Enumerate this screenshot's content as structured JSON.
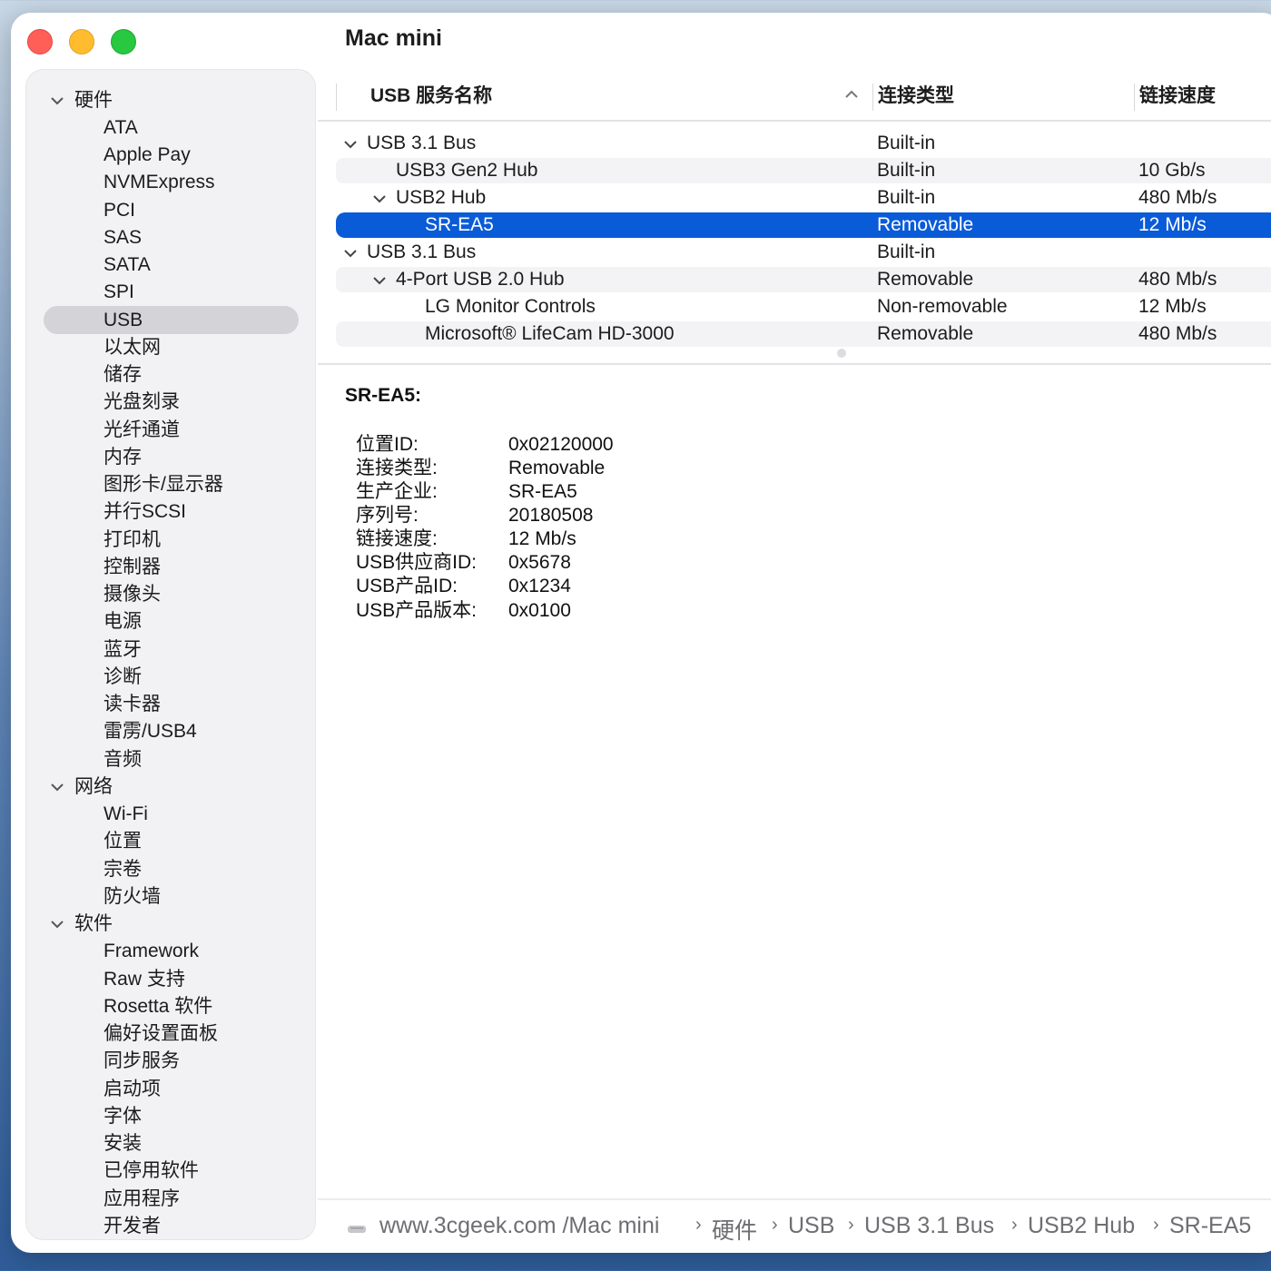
{
  "window": {
    "title": "Mac mini"
  },
  "sidebar": {
    "groups": [
      {
        "label": "硬件"
      },
      {
        "label": "网络"
      },
      {
        "label": "软件"
      }
    ],
    "hardware_items": [
      "ATA",
      "Apple Pay",
      "NVMExpress",
      "PCI",
      "SAS",
      "SATA",
      "SPI",
      "USB",
      "以太网",
      "储存",
      "光盘刻录",
      "光纤通道",
      "内存",
      "图形卡/显示器",
      "并行SCSI",
      "打印机",
      "控制器",
      "摄像头",
      "电源",
      "蓝牙",
      "诊断",
      "读卡器",
      "雷雳/USB4",
      "音频"
    ],
    "network_items": [
      "Wi-Fi",
      "位置",
      "宗卷",
      "防火墙"
    ],
    "software_items": [
      "Framework",
      "Raw 支持",
      "Rosetta 软件",
      "偏好设置面板",
      "同步服务",
      "启动项",
      "字体",
      "安装",
      "已停用软件",
      "应用程序",
      "开发者"
    ],
    "selected": "USB"
  },
  "table": {
    "columns": [
      "USB 服务名称",
      "连接类型",
      "链接速度"
    ],
    "sort_icon": "chevron-up-icon",
    "rows": [
      {
        "name": "USB 3.1 Bus",
        "type": "Built-in",
        "speed": ""
      },
      {
        "name": "USB3 Gen2 Hub",
        "type": "Built-in",
        "speed": "10 Gb/s"
      },
      {
        "name": "USB2 Hub",
        "type": "Built-in",
        "speed": "480 Mb/s"
      },
      {
        "name": "SR-EA5",
        "type": "Removable",
        "speed": "12 Mb/s"
      },
      {
        "name": "USB 3.1 Bus",
        "type": "Built-in",
        "speed": ""
      },
      {
        "name": "4-Port USB 2.0 Hub",
        "type": "Removable",
        "speed": "480 Mb/s"
      },
      {
        "name": "LG Monitor Controls",
        "type": "Non-removable",
        "speed": "12 Mb/s"
      },
      {
        "name": "Microsoft® LifeCam HD-3000",
        "type": "Removable",
        "speed": "480 Mb/s"
      }
    ],
    "selected_row": "SR-EA5"
  },
  "detail": {
    "title": "SR-EA5:",
    "fields": [
      {
        "key": "位置ID:",
        "value": "0x02120000"
      },
      {
        "key": "连接类型:",
        "value": "Removable"
      },
      {
        "key": "生产企业:",
        "value": "SR-EA5"
      },
      {
        "key": "序列号:",
        "value": "20180508"
      },
      {
        "key": "链接速度:",
        "value": "12 Mb/s"
      },
      {
        "key": "USB供应商ID:",
        "value": "0x5678"
      },
      {
        "key": "USB产品ID:",
        "value": "0x1234"
      },
      {
        "key": "USB产品版本:",
        "value": "0x0100"
      }
    ]
  },
  "pathbar": {
    "icon": "computer-icon",
    "segments": [
      "www.3cgeek.com /Mac mini",
      "硬件",
      "USB",
      "USB 3.1 Bus",
      "USB2 Hub",
      "SR-EA5"
    ]
  },
  "colors": {
    "selection_blue": "#0a5bd8",
    "sidebar_bg": "#f2f2f4",
    "close": "#ff5f57",
    "minimize": "#febc2e",
    "zoom": "#28c840"
  }
}
